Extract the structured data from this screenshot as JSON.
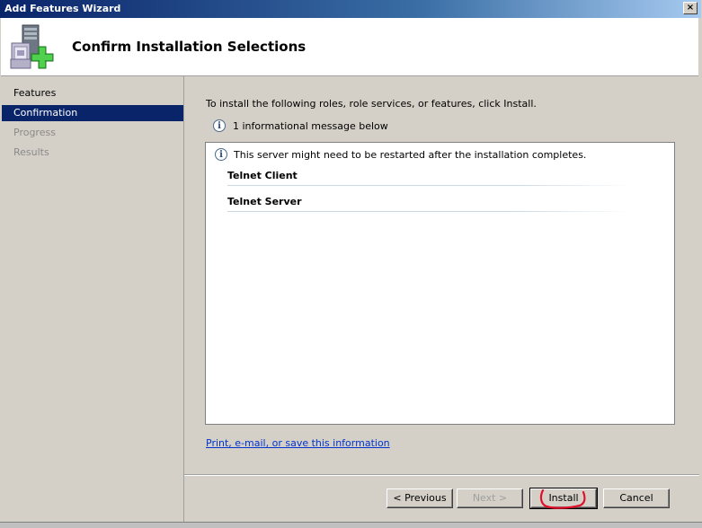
{
  "window": {
    "title": "Add Features Wizard",
    "close_label": "×"
  },
  "header": {
    "title": "Confirm Installation Selections"
  },
  "nav": {
    "items": [
      {
        "label": "Features",
        "state": "normal"
      },
      {
        "label": "Confirmation",
        "state": "active"
      },
      {
        "label": "Progress",
        "state": "disabled"
      },
      {
        "label": "Results",
        "state": "disabled"
      }
    ]
  },
  "main": {
    "instruction": "To install the following roles, role services, or features, click Install.",
    "info_count_text": "1 informational message below",
    "warning_text": "This server might need to be restarted after the installation completes.",
    "features": [
      {
        "name": "Telnet Client"
      },
      {
        "name": "Telnet Server"
      }
    ],
    "print_link": "Print, e-mail, or save this information"
  },
  "buttons": {
    "previous": "< Previous",
    "next": "Next >",
    "install": "Install",
    "cancel": "Cancel"
  },
  "icons": {
    "info": "i"
  },
  "colors": {
    "selection": "#0a246a",
    "link": "#0033cc",
    "annotation": "#e0102a"
  }
}
